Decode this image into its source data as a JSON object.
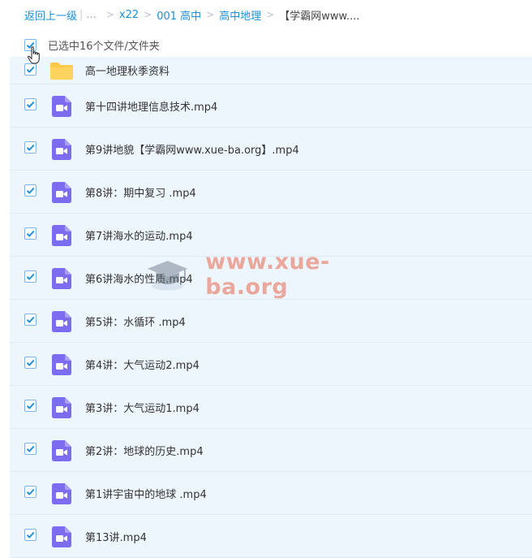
{
  "breadcrumb": {
    "back_label": "返回上一级",
    "ellipsis": "...",
    "items": [
      "x22",
      "001 高中",
      "高中地理"
    ],
    "current": "【学霸网www...."
  },
  "selection": {
    "text": "已选中16个文件/文件夹",
    "checked": true
  },
  "files": [
    {
      "name": "高一地理秋季资料",
      "type": "folder",
      "checked": true
    },
    {
      "name": "第十四讲地理信息技术.mp4",
      "type": "video",
      "checked": true
    },
    {
      "name": "第9讲地貌【学霸网www.xue-ba.org】.mp4",
      "type": "video",
      "checked": true
    },
    {
      "name": "第8讲：期中复习 .mp4",
      "type": "video",
      "checked": true
    },
    {
      "name": "第7讲海水的运动.mp4",
      "type": "video",
      "checked": true
    },
    {
      "name": "第6讲海水的性质.mp4",
      "type": "video",
      "checked": true
    },
    {
      "name": "第5讲：水循环 .mp4",
      "type": "video",
      "checked": true
    },
    {
      "name": "第4讲：大气运动2.mp4",
      "type": "video",
      "checked": true
    },
    {
      "name": "第3讲：大气运动1.mp4",
      "type": "video",
      "checked": true
    },
    {
      "name": "第2讲：地球的历史.mp4",
      "type": "video",
      "checked": true
    },
    {
      "name": "第1讲宇宙中的地球 .mp4",
      "type": "video",
      "checked": true
    },
    {
      "name": "第13讲.mp4",
      "type": "video",
      "checked": true
    }
  ],
  "watermark": {
    "text": "www.xue-ba.org"
  },
  "colors": {
    "link": "#1e8fd6",
    "check": "#1e8fd6",
    "row_bg": "#eef6fd",
    "folder": "#fcc94b",
    "video": "#7b6cf0"
  },
  "icons": {
    "folder": "folder-icon",
    "video": "video-file-icon",
    "cursor": "hand-pointer-icon",
    "check": "checkmark-icon"
  }
}
